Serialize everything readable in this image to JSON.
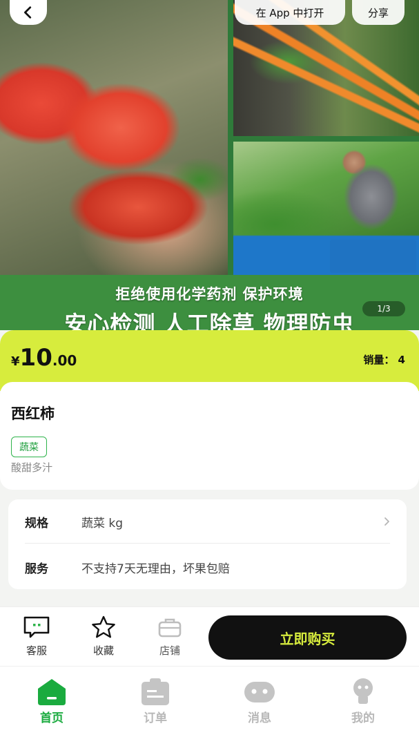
{
  "header": {
    "open_in_app": "在 App 中打开",
    "share": "分享"
  },
  "banner": {
    "slogan_line1": "拒绝使用化学药剂 保护环境",
    "slogan_line2": "安心检测 人工除草 物理防虫",
    "page_indicator": "1/3"
  },
  "price": {
    "currency": "¥",
    "integer": "10",
    "decimal": ".00",
    "sales_label": "销量： 4"
  },
  "product": {
    "name": "西红柿",
    "tag": "蔬菜",
    "description": "酸甜多汁"
  },
  "specs": {
    "spec_label": "规格",
    "spec_value": "蔬菜 kg",
    "service_label": "服务",
    "service_value": "不支持7天无理由，坏果包赔"
  },
  "actions": {
    "customer_service": "客服",
    "favorite": "收藏",
    "shop": "店铺",
    "buy_now": "立即购买"
  },
  "tabs": {
    "home": "首页",
    "orders": "订单",
    "messages": "消息",
    "me": "我的"
  },
  "colors": {
    "accent_lime": "#d7ec3d",
    "brand_green": "#1aab3f",
    "slogan_green": "#3d8f3f",
    "tag_green": "#23a141"
  },
  "icons": {
    "back": "chevron-left-icon",
    "spec_arrow": "chevron-right-icon",
    "service": "chat-bubble-icon",
    "favorite": "star-icon",
    "shop": "briefcase-icon",
    "home": "home-icon",
    "orders": "clipboard-icon",
    "messages": "message-icon",
    "me": "user-icon"
  }
}
